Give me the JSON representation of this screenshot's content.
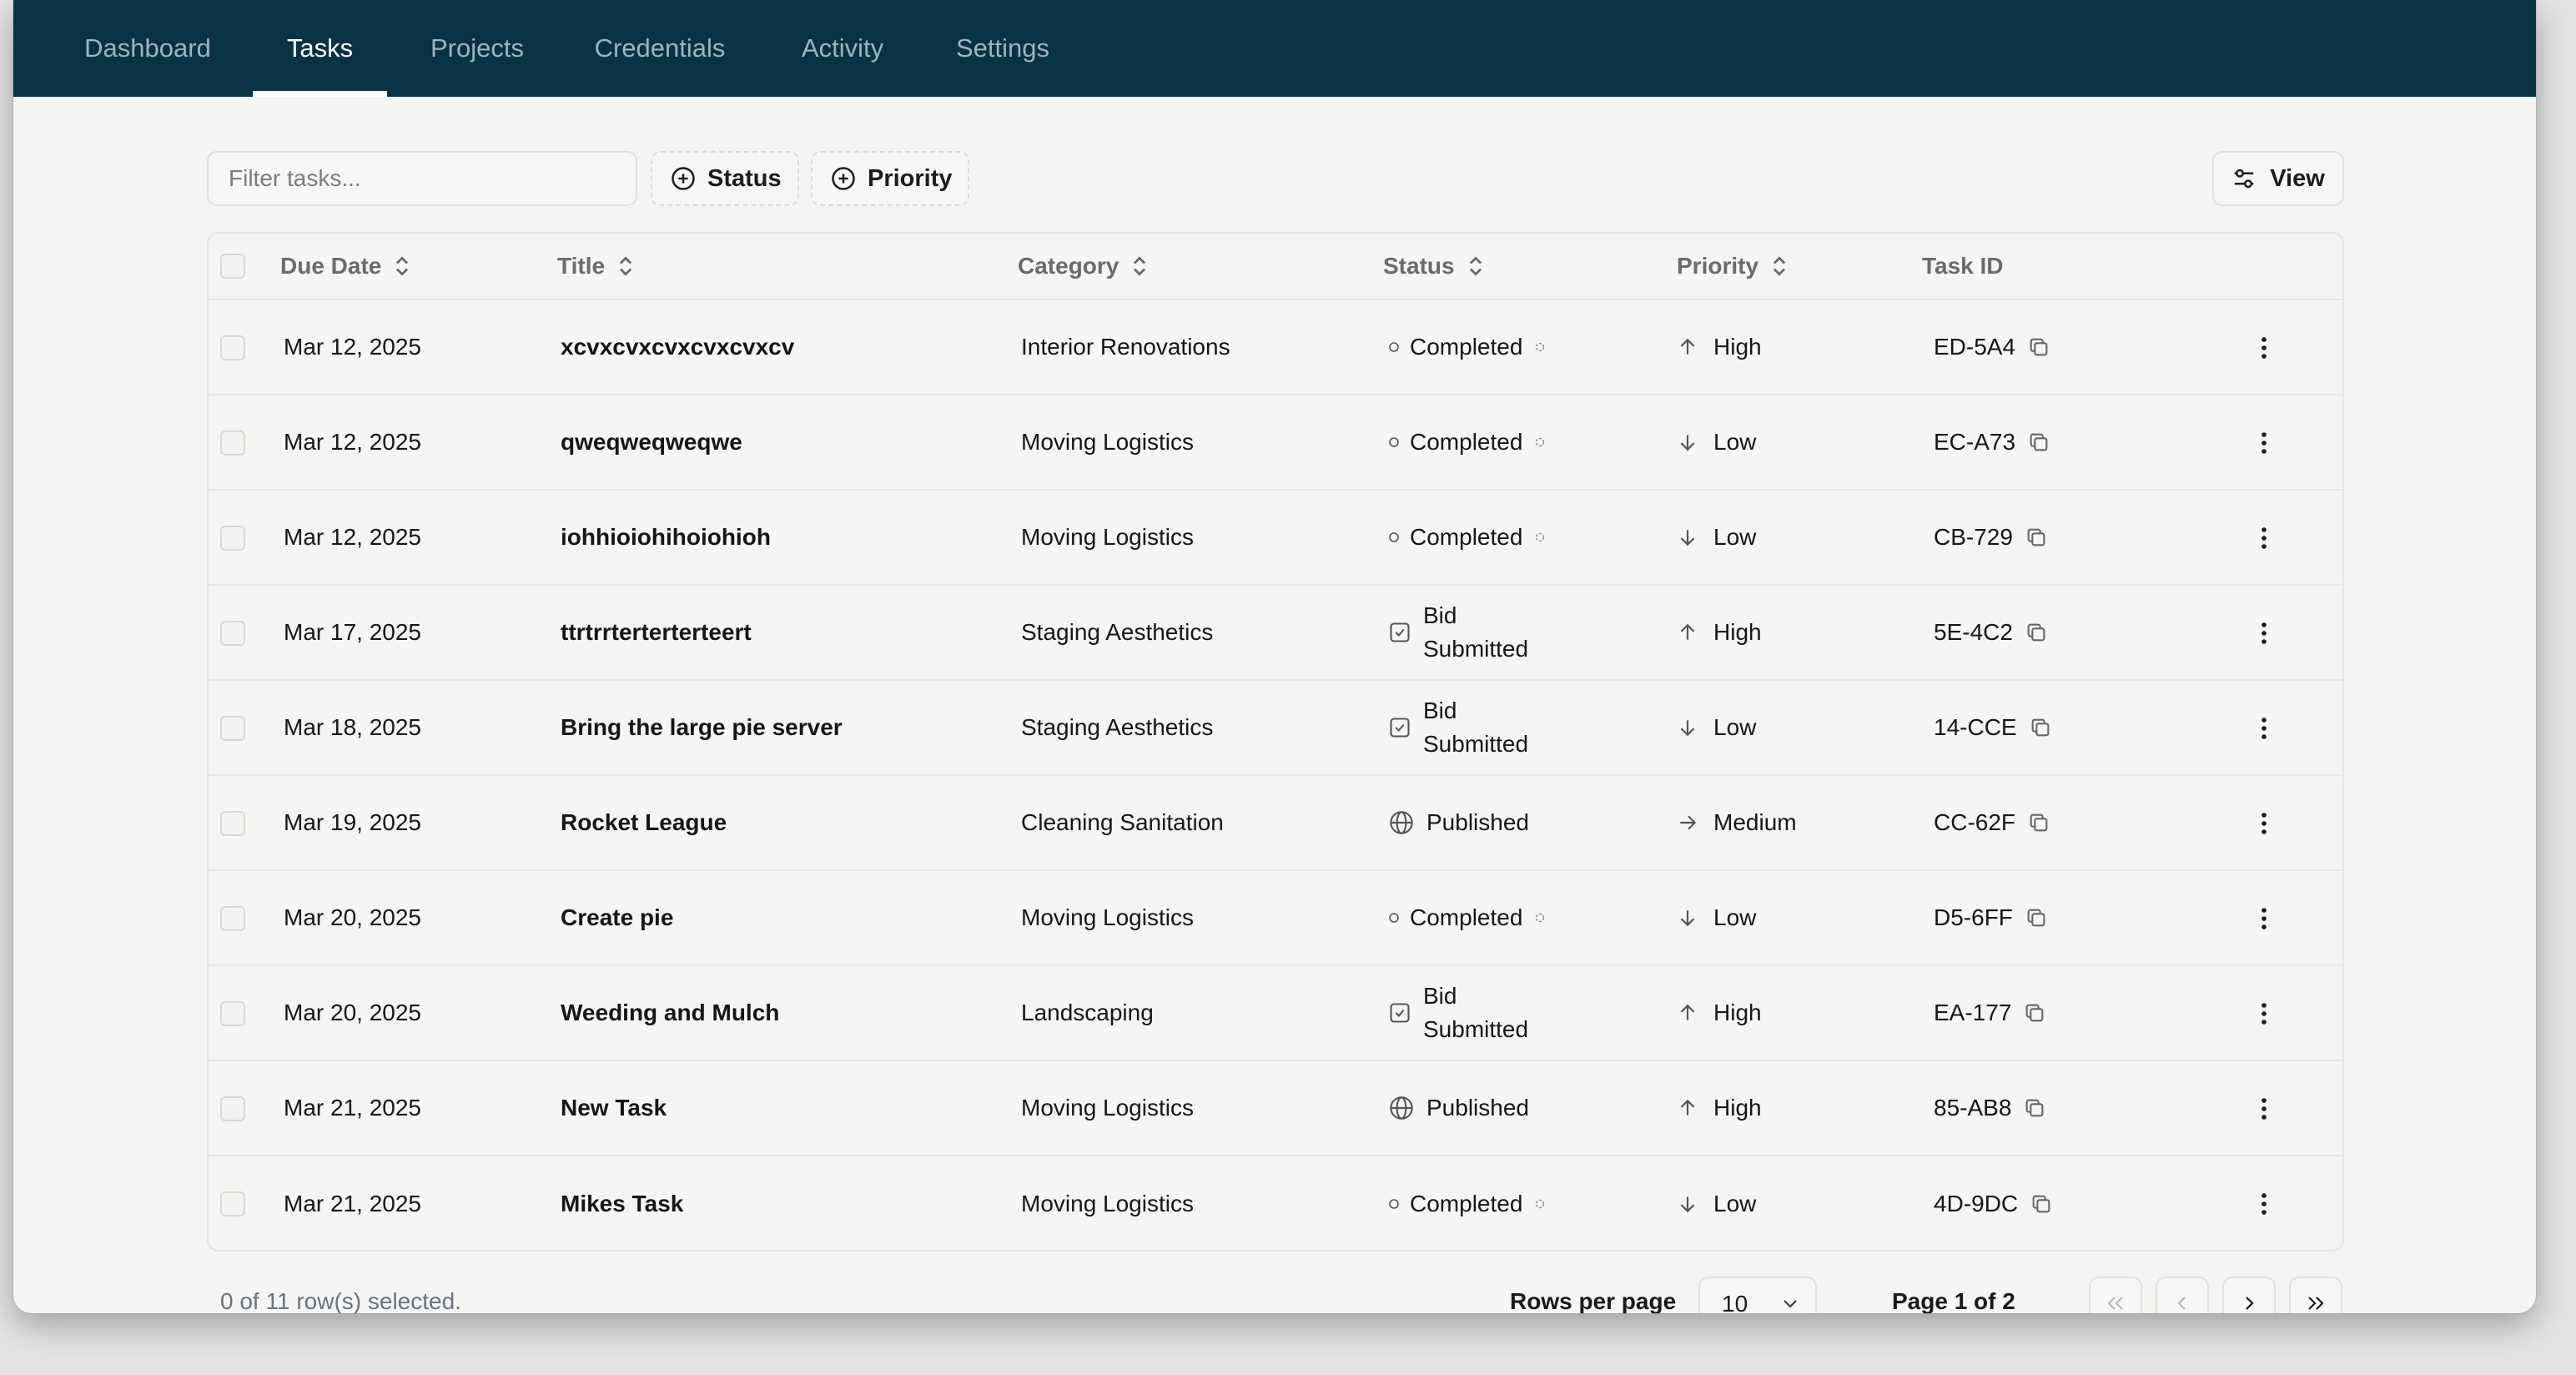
{
  "nav": {
    "tabs": [
      {
        "label": "Dashboard",
        "active": false
      },
      {
        "label": "Tasks",
        "active": true
      },
      {
        "label": "Projects",
        "active": false
      },
      {
        "label": "Credentials",
        "active": false
      },
      {
        "label": "Activity",
        "active": false
      },
      {
        "label": "Settings",
        "active": false
      }
    ]
  },
  "toolbar": {
    "filter_placeholder": "Filter tasks...",
    "filter_value": "",
    "status_filter_label": "Status",
    "priority_filter_label": "Priority",
    "view_label": "View"
  },
  "table": {
    "columns": {
      "due_date": "Due Date",
      "title": "Title",
      "category": "Category",
      "status": "Status",
      "priority": "Priority",
      "task_id": "Task ID"
    },
    "rows": [
      {
        "due_date": "Mar 12, 2025",
        "title": "xcvxcvxcvxcvxcvxcv",
        "category": "Interior Renovations",
        "status": "Completed",
        "status_icon": "completed-dot-icon",
        "priority": "High",
        "priority_icon": "arrow-up-icon",
        "task_id": "ED-5A4"
      },
      {
        "due_date": "Mar 12, 2025",
        "title": "qweqweqweqwe",
        "category": "Moving Logistics",
        "status": "Completed",
        "status_icon": "completed-dot-icon",
        "priority": "Low",
        "priority_icon": "arrow-down-icon",
        "task_id": "EC-A73"
      },
      {
        "due_date": "Mar 12, 2025",
        "title": "iohhioiohihoiohioh",
        "category": "Moving Logistics",
        "status": "Completed",
        "status_icon": "completed-dot-icon",
        "priority": "Low",
        "priority_icon": "arrow-down-icon",
        "task_id": "CB-729"
      },
      {
        "due_date": "Mar 17, 2025",
        "title": "ttrtrrterterterteert",
        "category": "Staging Aesthetics",
        "status": "Bid Submitted",
        "status_icon": "check-square-icon",
        "priority": "High",
        "priority_icon": "arrow-up-icon",
        "task_id": "5E-4C2"
      },
      {
        "due_date": "Mar 18, 2025",
        "title": "Bring the large pie server",
        "category": "Staging Aesthetics",
        "status": "Bid Submitted",
        "status_icon": "check-square-icon",
        "priority": "Low",
        "priority_icon": "arrow-down-icon",
        "task_id": "14-CCE"
      },
      {
        "due_date": "Mar 19, 2025",
        "title": "Rocket League",
        "category": "Cleaning Sanitation",
        "status": "Published",
        "status_icon": "globe-icon",
        "priority": "Medium",
        "priority_icon": "arrow-right-icon",
        "task_id": "CC-62F"
      },
      {
        "due_date": "Mar 20, 2025",
        "title": "Create pie",
        "category": "Moving Logistics",
        "status": "Completed",
        "status_icon": "completed-dot-icon",
        "priority": "Low",
        "priority_icon": "arrow-down-icon",
        "task_id": "D5-6FF"
      },
      {
        "due_date": "Mar 20, 2025",
        "title": "Weeding and Mulch",
        "category": "Landscaping",
        "status": "Bid Submitted",
        "status_icon": "check-square-icon",
        "priority": "High",
        "priority_icon": "arrow-up-icon",
        "task_id": "EA-177"
      },
      {
        "due_date": "Mar 21, 2025",
        "title": "New Task",
        "category": "Moving Logistics",
        "status": "Published",
        "status_icon": "globe-icon",
        "priority": "High",
        "priority_icon": "arrow-up-icon",
        "task_id": "85-AB8"
      },
      {
        "due_date": "Mar 21, 2025",
        "title": "Mikes Task",
        "category": "Moving Logistics",
        "status": "Completed",
        "status_icon": "completed-dot-icon",
        "priority": "Low",
        "priority_icon": "arrow-down-icon",
        "task_id": "4D-9DC"
      }
    ]
  },
  "footer": {
    "selection_text": "0 of 11 row(s) selected.",
    "rows_per_page_label": "Rows per page",
    "rows_per_page_value": "10",
    "page_text": "Page 1 of 2"
  },
  "colors": {
    "nav_background": "#083344",
    "page_background": "#f5f5f4",
    "border": "#e4e4e2"
  }
}
